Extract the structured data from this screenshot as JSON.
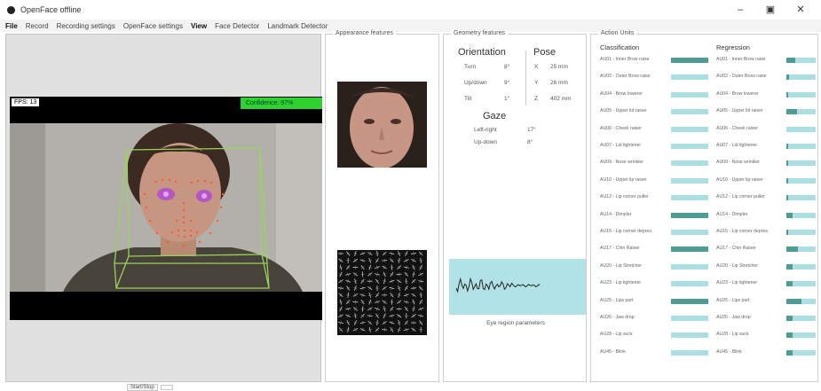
{
  "window": {
    "title": "OpenFace offline",
    "controls": {
      "minimize": "–",
      "maximize": "▣",
      "close": "✕"
    }
  },
  "menu": [
    {
      "label": "File"
    },
    {
      "label": "Record"
    },
    {
      "label": "Recording settings"
    },
    {
      "label": "OpenFace settings"
    },
    {
      "label": "View"
    },
    {
      "label": "Face Detector"
    },
    {
      "label": "Landmark Detector"
    }
  ],
  "video": {
    "fps_label": "FPS: 13",
    "confidence_label": "Confidence: 97%"
  },
  "appearance": {
    "legend": "Appearance features"
  },
  "geometry": {
    "legend": "Geometry features",
    "orientation_title": "Orientation",
    "pose_title": "Pose",
    "gaze_title": "Gaze",
    "orientation_rows": [
      {
        "label": "Turn",
        "value": "8°"
      },
      {
        "label": "Up/down",
        "value": "9°"
      },
      {
        "label": "Tilt",
        "value": "1°"
      }
    ],
    "pose_rows": [
      {
        "axis": "X",
        "value": "25 mm"
      },
      {
        "axis": "Y",
        "value": "26 mm"
      },
      {
        "axis": "Z",
        "value": "402 mm"
      }
    ],
    "gaze_rows": [
      {
        "label": "Left-right",
        "value": "17°"
      },
      {
        "label": "Up-down",
        "value": "8°"
      }
    ],
    "eye_caption": "Eye region parameters",
    "trace_color": "#222222",
    "plot_color": "#b1e2e7"
  },
  "action_units": {
    "legend": "Action Units",
    "classification_title": "Classification",
    "regression_title": "Regression",
    "bar_color": "#acdfe2",
    "fill_color": "#4e9c94",
    "labels": [
      "AU01 - Inner Brow raise",
      "AU02 - Outer Brow raise",
      "AU04 - Brow lowerer",
      "AU05 - Upper lid raiser",
      "AU06 - Cheek raiser",
      "AU07 - Lid tightener",
      "AU09 - Nose wrinkler",
      "AU10 - Upper lip raiser",
      "AU12 - Lip corner puller",
      "AU14 - Dimpler",
      "AU15 - Lip corner depres.",
      "AU17 - Chin Raiser",
      "AU20 - Lip Stretcher",
      "AU23 - Lip tightener",
      "AU25 - Lips part",
      "AU26 - Jaw drop",
      "AU28 - Lip suck",
      "AU45 - Blink"
    ],
    "classification": [
      1,
      0,
      0,
      0,
      0,
      0,
      0,
      0,
      0,
      1,
      0,
      1,
      0,
      0,
      1,
      0,
      0,
      0
    ],
    "regression": [
      0.3,
      0.08,
      0.05,
      0.35,
      0.0,
      0.05,
      0.05,
      0.05,
      0.05,
      0.2,
      0.05,
      0.38,
      0.2,
      0.2,
      0.52,
      0.22,
      0.22,
      0.22
    ]
  },
  "status": {
    "label": "Start/Stop"
  }
}
